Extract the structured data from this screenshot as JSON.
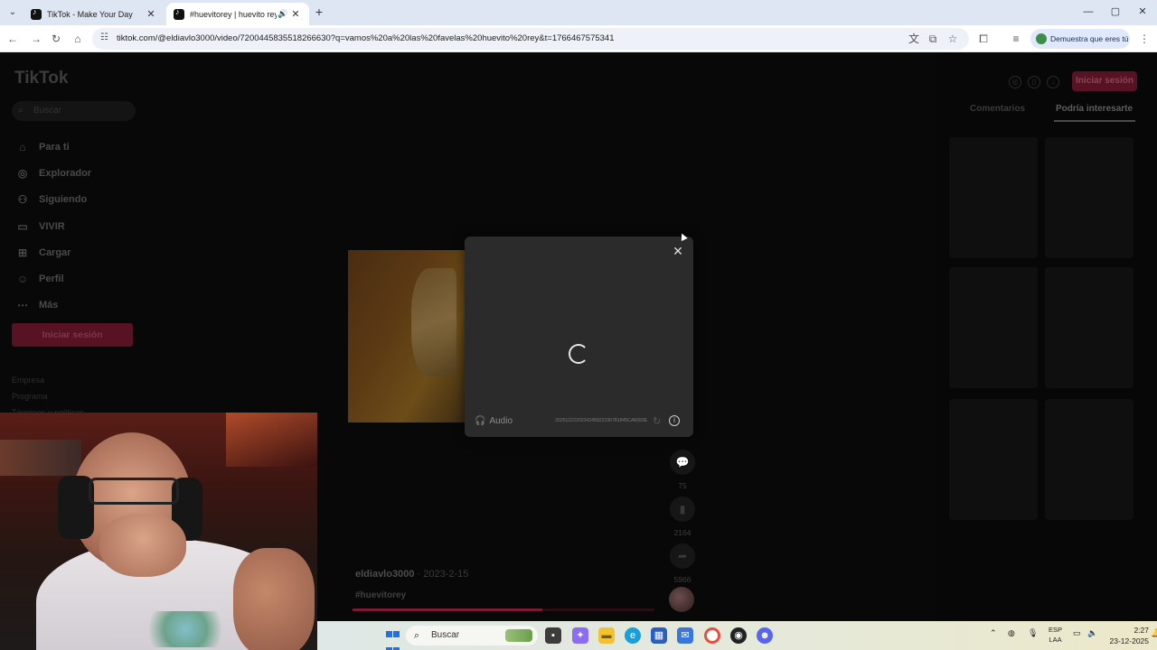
{
  "browser": {
    "tabs": [
      {
        "title": "TikTok - Make Your Day"
      },
      {
        "title": "#huevitorey | huevito rey a"
      }
    ],
    "url": "tiktok.com/@eldiavlo3000/video/7200445835518266630?q=vamos%20a%20las%20favelas%20huevito%20rey&t=1766467575341",
    "verify_label": "Demuestra que eres tú"
  },
  "tiktok": {
    "logo": "TikTok",
    "search_placeholder": "Buscar",
    "nav": [
      {
        "label": "Para ti",
        "icon": "home-icon"
      },
      {
        "label": "Explorador",
        "icon": "compass-icon"
      },
      {
        "label": "Siguiendo",
        "icon": "following-icon"
      },
      {
        "label": "VIVIR",
        "icon": "live-icon"
      },
      {
        "label": "Cargar",
        "icon": "upload-icon"
      },
      {
        "label": "Perfil",
        "icon": "profile-icon"
      },
      {
        "label": "Más",
        "icon": "more-icon"
      }
    ],
    "login_button": "Iniciar sesión",
    "footer_links": [
      "Empresa",
      "Programa",
      "Términos y políticas"
    ],
    "right_login": "Iniciar sesión",
    "right_tabs": {
      "comments": "Comentarios",
      "interest": "Podría interesarte"
    },
    "actions": {
      "comments": "75",
      "saves": "2164",
      "shares": "5966"
    },
    "author": "eldiavlo3000",
    "date": " · 2023-2-15",
    "hashtag": "#huevitorey",
    "progress": 0.63
  },
  "popup": {
    "audio_label": "Audio",
    "code": "2025122220224245822236781845CA6083E"
  },
  "taskbar": {
    "search": "Buscar",
    "lang_top": "ESP",
    "lang_bottom": "LAA",
    "time": "2:27",
    "date": "23-12-2025"
  }
}
